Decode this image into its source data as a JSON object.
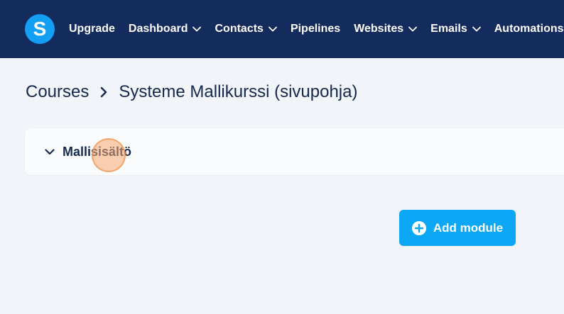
{
  "topbar": {
    "logo_letter": "S",
    "nav": [
      {
        "label": "Upgrade",
        "has_dropdown": false
      },
      {
        "label": "Dashboard",
        "has_dropdown": true
      },
      {
        "label": "Contacts",
        "has_dropdown": true
      },
      {
        "label": "Pipelines",
        "has_dropdown": false
      },
      {
        "label": "Websites",
        "has_dropdown": true
      },
      {
        "label": "Emails",
        "has_dropdown": true
      },
      {
        "label": "Automations",
        "has_dropdown": true
      }
    ]
  },
  "breadcrumb": {
    "parent": "Courses",
    "current": "Systeme Mallikurssi (sivupohja)"
  },
  "module": {
    "title": "Mallisisältö",
    "expanded": true
  },
  "actions": {
    "add_module_label": "Add module"
  },
  "colors": {
    "topbar_bg": "#142b5e",
    "logo_bg": "#139ff4",
    "page_bg": "#f1f4f8",
    "primary_button": "#0ca7f5",
    "text_dark": "#15284e"
  },
  "icons": {
    "logo": "systeme-logo-icon",
    "dropdown": "chevron-down-icon",
    "breadcrumb_separator": "chevron-right-icon",
    "module_toggle": "chevron-down-icon",
    "add": "plus-circle-icon"
  }
}
